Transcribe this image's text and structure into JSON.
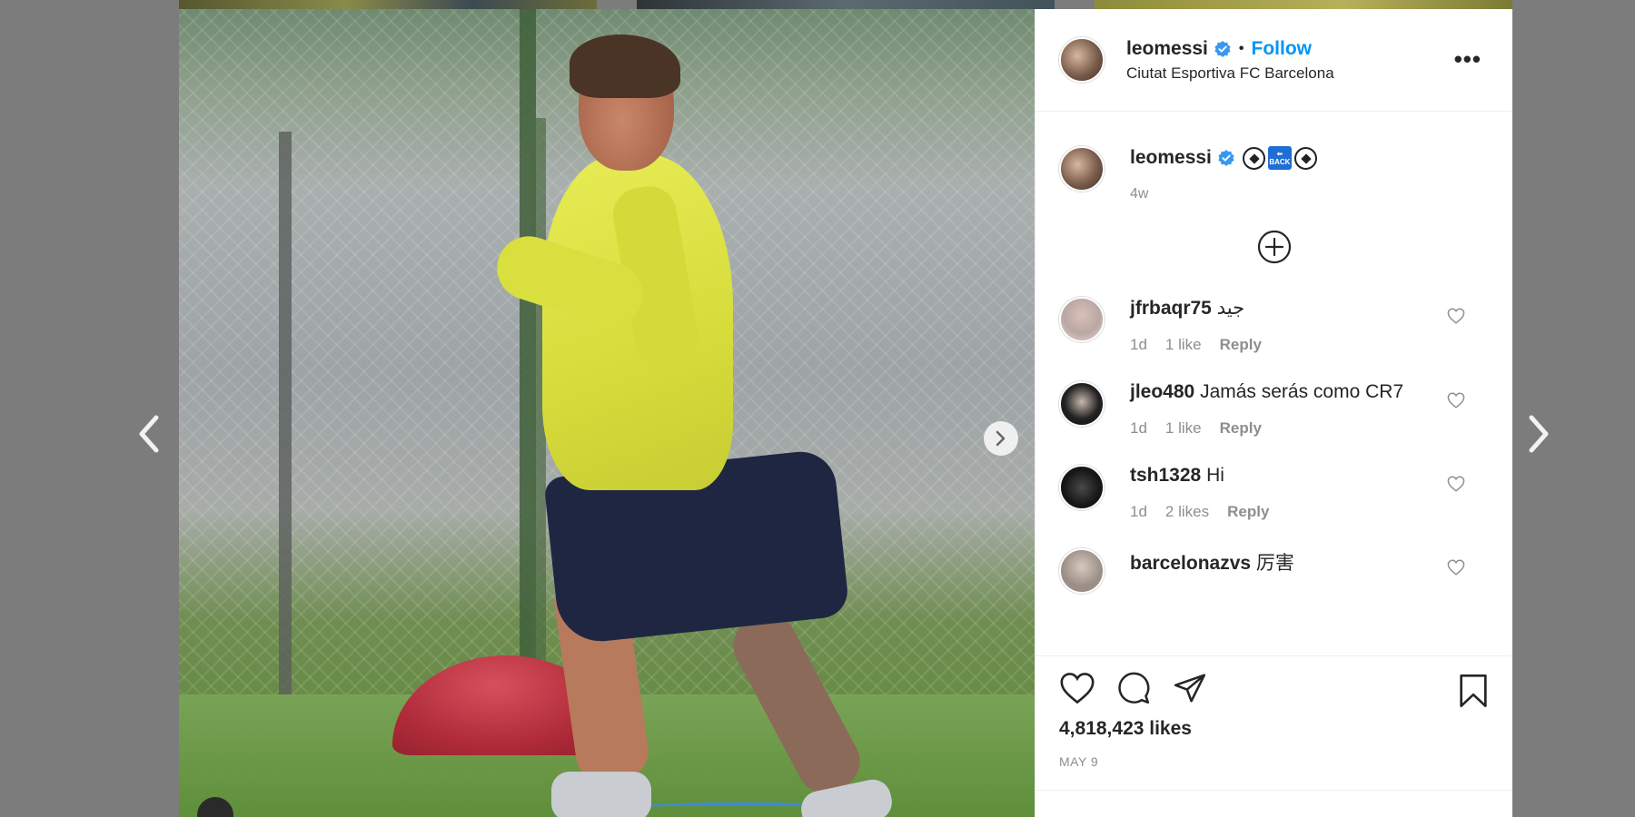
{
  "post": {
    "author": "leomessi",
    "follow_label": "Follow",
    "separator": "•",
    "location": "Ciutat Esportiva FC Barcelona",
    "more_label": "•••",
    "caption_back_text": "BACK",
    "caption_age": "4w",
    "likes": "4,818,423 likes",
    "date": "MAY 9"
  },
  "comments": [
    {
      "user": "jfrbaqr75",
      "text": "جيد",
      "age": "1d",
      "likes": "1 like",
      "reply": "Reply"
    },
    {
      "user": "jleo480",
      "text": "Jamás serás como CR7",
      "age": "1d",
      "likes": "1 like",
      "reply": "Reply"
    },
    {
      "user": "tsh1328",
      "text": "Hi",
      "age": "1d",
      "likes": "2 likes",
      "reply": "Reply"
    },
    {
      "user": "barcelonazvs",
      "text": "厉害"
    }
  ],
  "colors": {
    "accent": "#0095f6",
    "verified": "#3897f0",
    "muted": "#8e8e8e"
  },
  "icons": [
    "verified-badge-icon",
    "more-options-icon",
    "soccer-ball-icon",
    "back-arrow-icon",
    "load-more-plus-icon",
    "heart-icon",
    "comment-icon",
    "share-icon",
    "bookmark-icon",
    "chevron-left-icon",
    "chevron-right-icon"
  ]
}
